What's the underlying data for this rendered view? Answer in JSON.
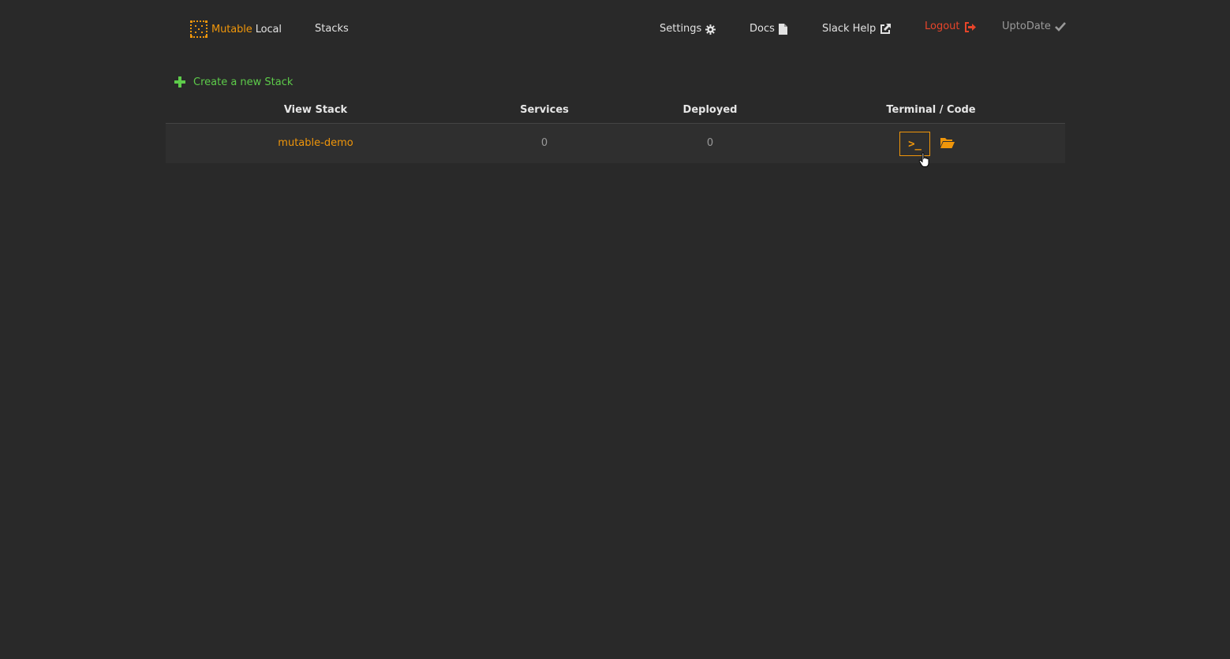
{
  "navbar": {
    "brand_accent": "Mutable",
    "brand_rest": "Local",
    "stacks_label": "Stacks",
    "settings_label": "Settings",
    "docs_label": "Docs",
    "slack_label": "Slack Help",
    "logout_label": "Logout",
    "status_label": "UptoDate"
  },
  "actions": {
    "create_label": "Create a new Stack"
  },
  "table": {
    "columns": [
      "View Stack",
      "Services",
      "Deployed",
      "Terminal / Code"
    ],
    "rows": [
      {
        "name": "mutable-demo",
        "services": "0",
        "deployed": "0",
        "terminal_symbol": ">_"
      }
    ]
  },
  "colors": {
    "background": "#292929",
    "accent": "#f0960a",
    "create": "#5dcb4a",
    "logout": "#e8452a",
    "muted": "#9a9a9a"
  },
  "icons": {
    "brand": "mutable-logo-icon",
    "settings": "gear-icon",
    "docs": "file-icon",
    "slack": "external-link-icon",
    "logout": "sign-out-icon",
    "status": "check-icon",
    "create": "plus-icon",
    "terminal": "terminal-icon",
    "code": "folder-open-icon",
    "pointer": "hand-cursor-icon"
  }
}
